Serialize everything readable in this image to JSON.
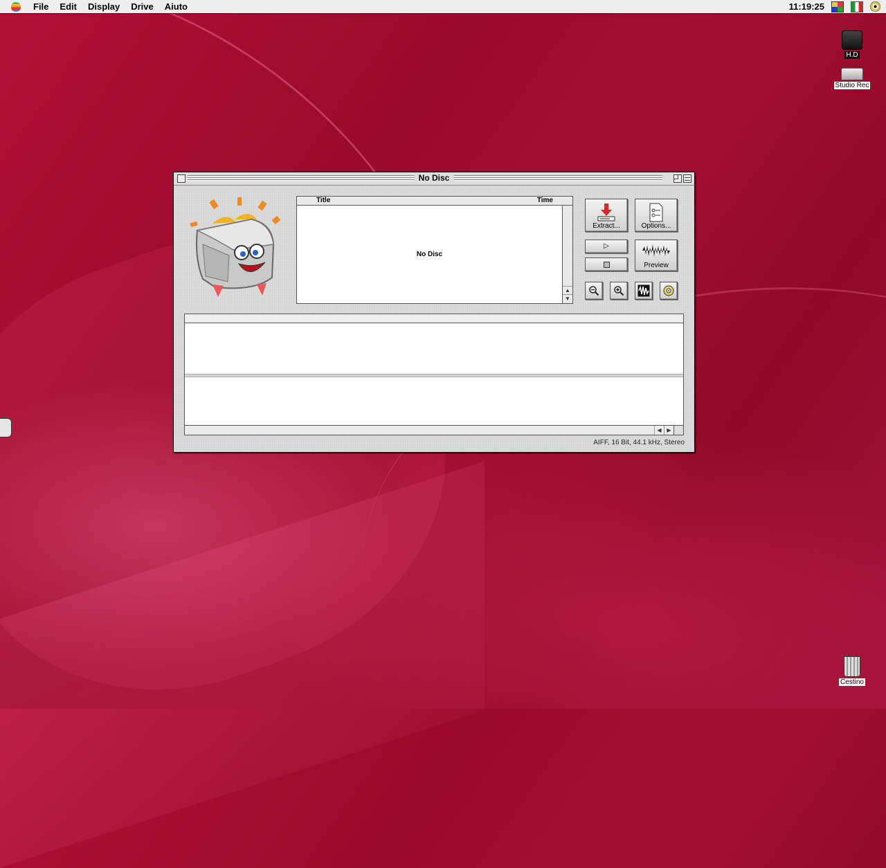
{
  "menubar": {
    "items": [
      "File",
      "Edit",
      "Display",
      "Drive",
      "Aiuto"
    ],
    "clock": "11:19:25"
  },
  "desktop": {
    "icons": [
      {
        "label": "H.D"
      },
      {
        "label": "Studio Rec"
      },
      {
        "label": "Cestino"
      }
    ]
  },
  "window": {
    "title": "No Disc",
    "list": {
      "col_title": "Title",
      "col_time": "Time",
      "empty_text": "No Disc"
    },
    "buttons": {
      "extract": "Extract...",
      "options": "Options...",
      "preview": "Preview"
    },
    "status": "AIFF, 16 Bit, 44.1 kHz, Stereo"
  },
  "colors": {
    "accent_red": "#d62828",
    "desktop": "#a30d30"
  }
}
